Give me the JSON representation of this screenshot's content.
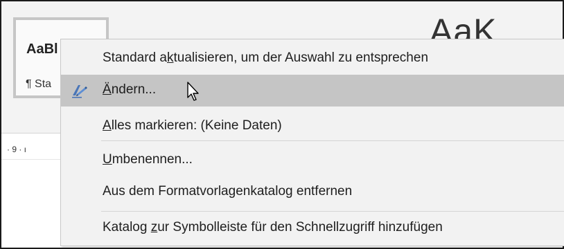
{
  "ribbon": {
    "style_tile_sample": "AaBl",
    "style_tile_name": "¶ Sta",
    "big_sample": "AaK",
    "ruler_text": "· 9 · ı"
  },
  "context_menu": {
    "items": [
      {
        "pre": "Standard a",
        "ul": "k",
        "post": "tualisieren, um der Auswahl zu entsprechen"
      },
      {
        "pre": "",
        "ul": "Ä",
        "post": "ndern..."
      },
      {
        "pre": "",
        "ul": "A",
        "post": "lles markieren: (Keine Daten)"
      },
      {
        "pre": "",
        "ul": "U",
        "post": "mbenennen..."
      },
      {
        "pre": "Aus dem Formatvorla",
        "ul": "g",
        "post": "enkatalog entfernen"
      },
      {
        "pre": "Katalog ",
        "ul": "z",
        "post": "ur Symbolleiste für den Schnellzugriff hinzufügen"
      }
    ],
    "hover_color": "#c5c5c5",
    "icon": "edit-style-pen-icon"
  }
}
